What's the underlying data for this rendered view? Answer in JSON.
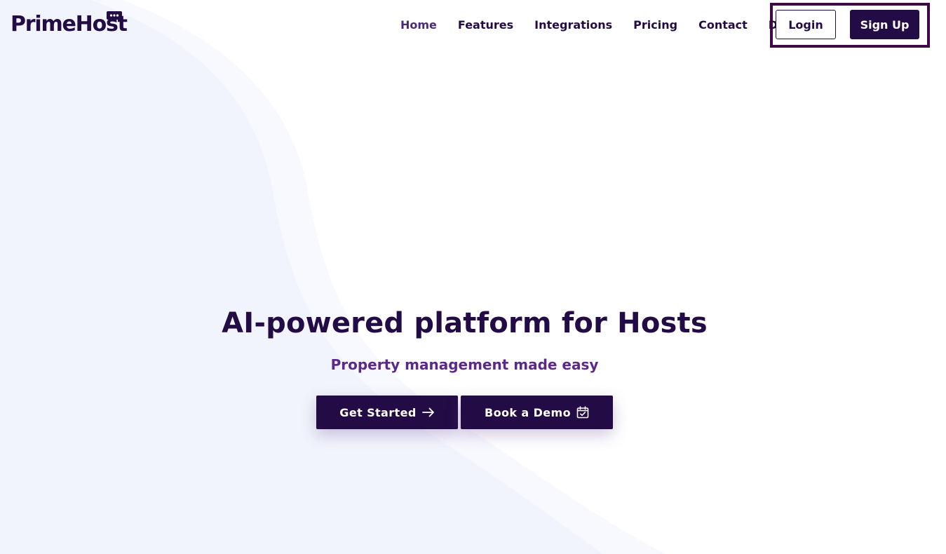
{
  "brand": {
    "name": "PrimeHost"
  },
  "nav": {
    "items": [
      {
        "label": "Home",
        "active": true
      },
      {
        "label": "Features"
      },
      {
        "label": "Integrations"
      },
      {
        "label": "Pricing"
      },
      {
        "label": "Contact"
      },
      {
        "label": "Docs"
      }
    ]
  },
  "auth": {
    "login_label": "Login",
    "signup_label": "Sign Up"
  },
  "hero": {
    "title": "AI-powered platform for Hosts",
    "subtitle": "Property management made easy",
    "primary_cta": "Get Started",
    "secondary_cta": "Book a Demo"
  },
  "icons": {
    "logo_bubble": "chat-bubble-icon",
    "primary_cta": "arrow-right-icon",
    "secondary_cta": "calendar-check-icon"
  },
  "colors": {
    "primary": "#230c45",
    "accent": "#5a2a86",
    "highlight_box": "#3d0a45",
    "background_wave": "#f1f4fc"
  }
}
